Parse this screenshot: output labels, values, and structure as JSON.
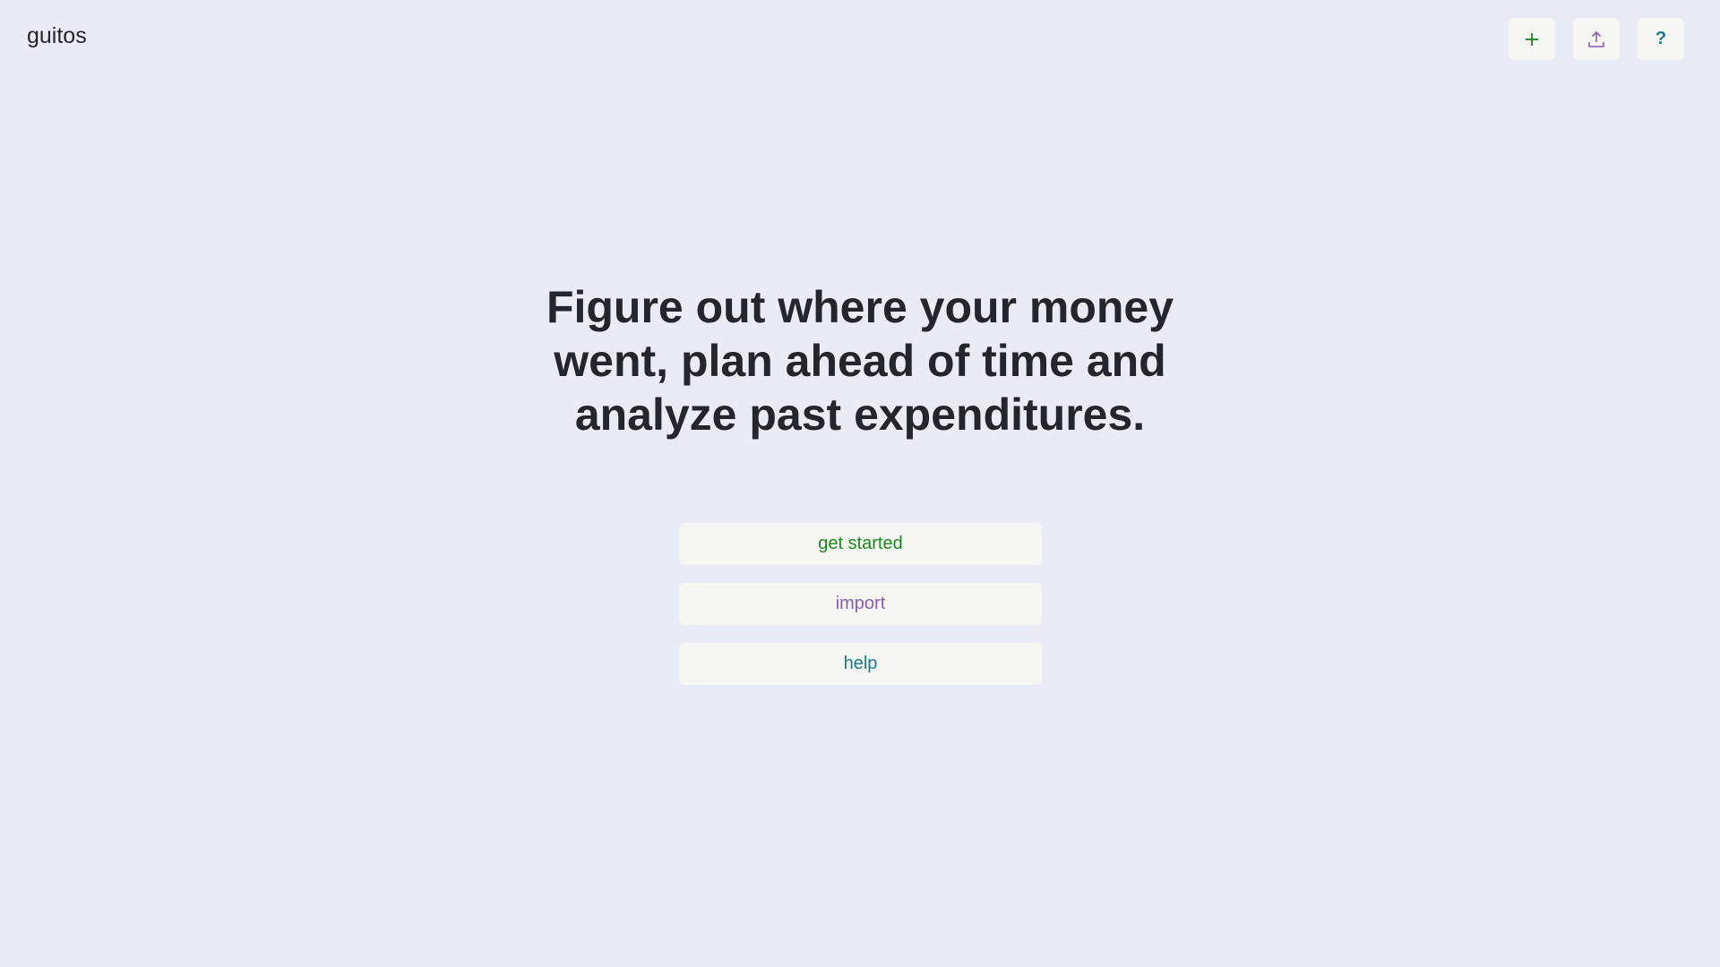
{
  "app": {
    "brand": "guitos"
  },
  "header": {
    "buttons": [
      {
        "icon": "plus-icon",
        "color": "#1a8a1f"
      },
      {
        "icon": "upload-icon",
        "color": "#8a5cb8"
      },
      {
        "icon": "question-icon",
        "label": "?",
        "color": "#177c8a"
      }
    ]
  },
  "hero": {
    "headline": "Figure out where your money went, plan ahead of time and analyze past expenditures."
  },
  "actions": {
    "get_started": "get started",
    "import": "import",
    "help": "help"
  },
  "colors": {
    "background": "#e9ebf6",
    "button_bg": "#f6f7f2",
    "text": "#23252f",
    "green": "#1a8a1f",
    "purple": "#8a5cb8",
    "teal": "#177c8a"
  }
}
